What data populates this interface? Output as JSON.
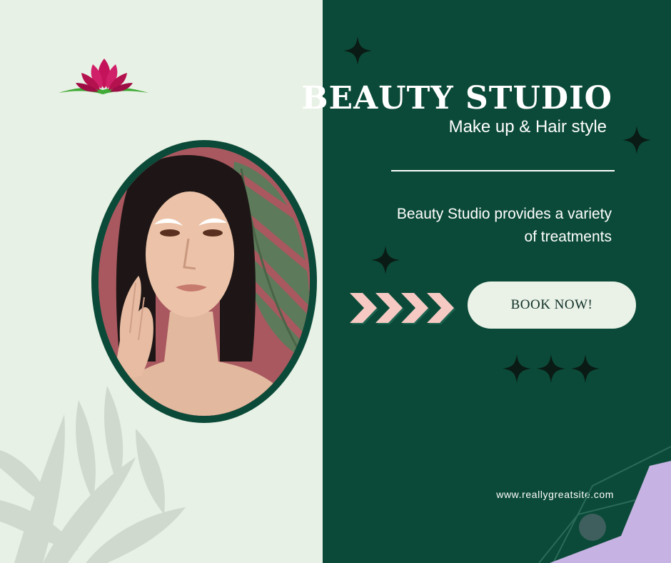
{
  "brand": {
    "title": "BEAUTY STUDIO",
    "subtitle": "Make up & Hair style",
    "description": "Beauty Studio provides a variety of treatments",
    "cta_label": "BOOK  NOW!",
    "website": "www.reallygreatsite.com"
  },
  "colors": {
    "left_background": "#e8f1e5",
    "right_background": "#0b4a38",
    "chevron_pink": "#f6c9c3",
    "lotus_magenta": "#c4135a",
    "leaf_green": "#3faa35",
    "accent_lavender": "#c7b3e3",
    "button_background": "#eaf2e8",
    "sparkle_color": "#0a1a14"
  },
  "icons": {
    "logo": "lotus-icon",
    "sparkle": "four-point-star-icon",
    "arrows": "chevron-right-icon"
  }
}
